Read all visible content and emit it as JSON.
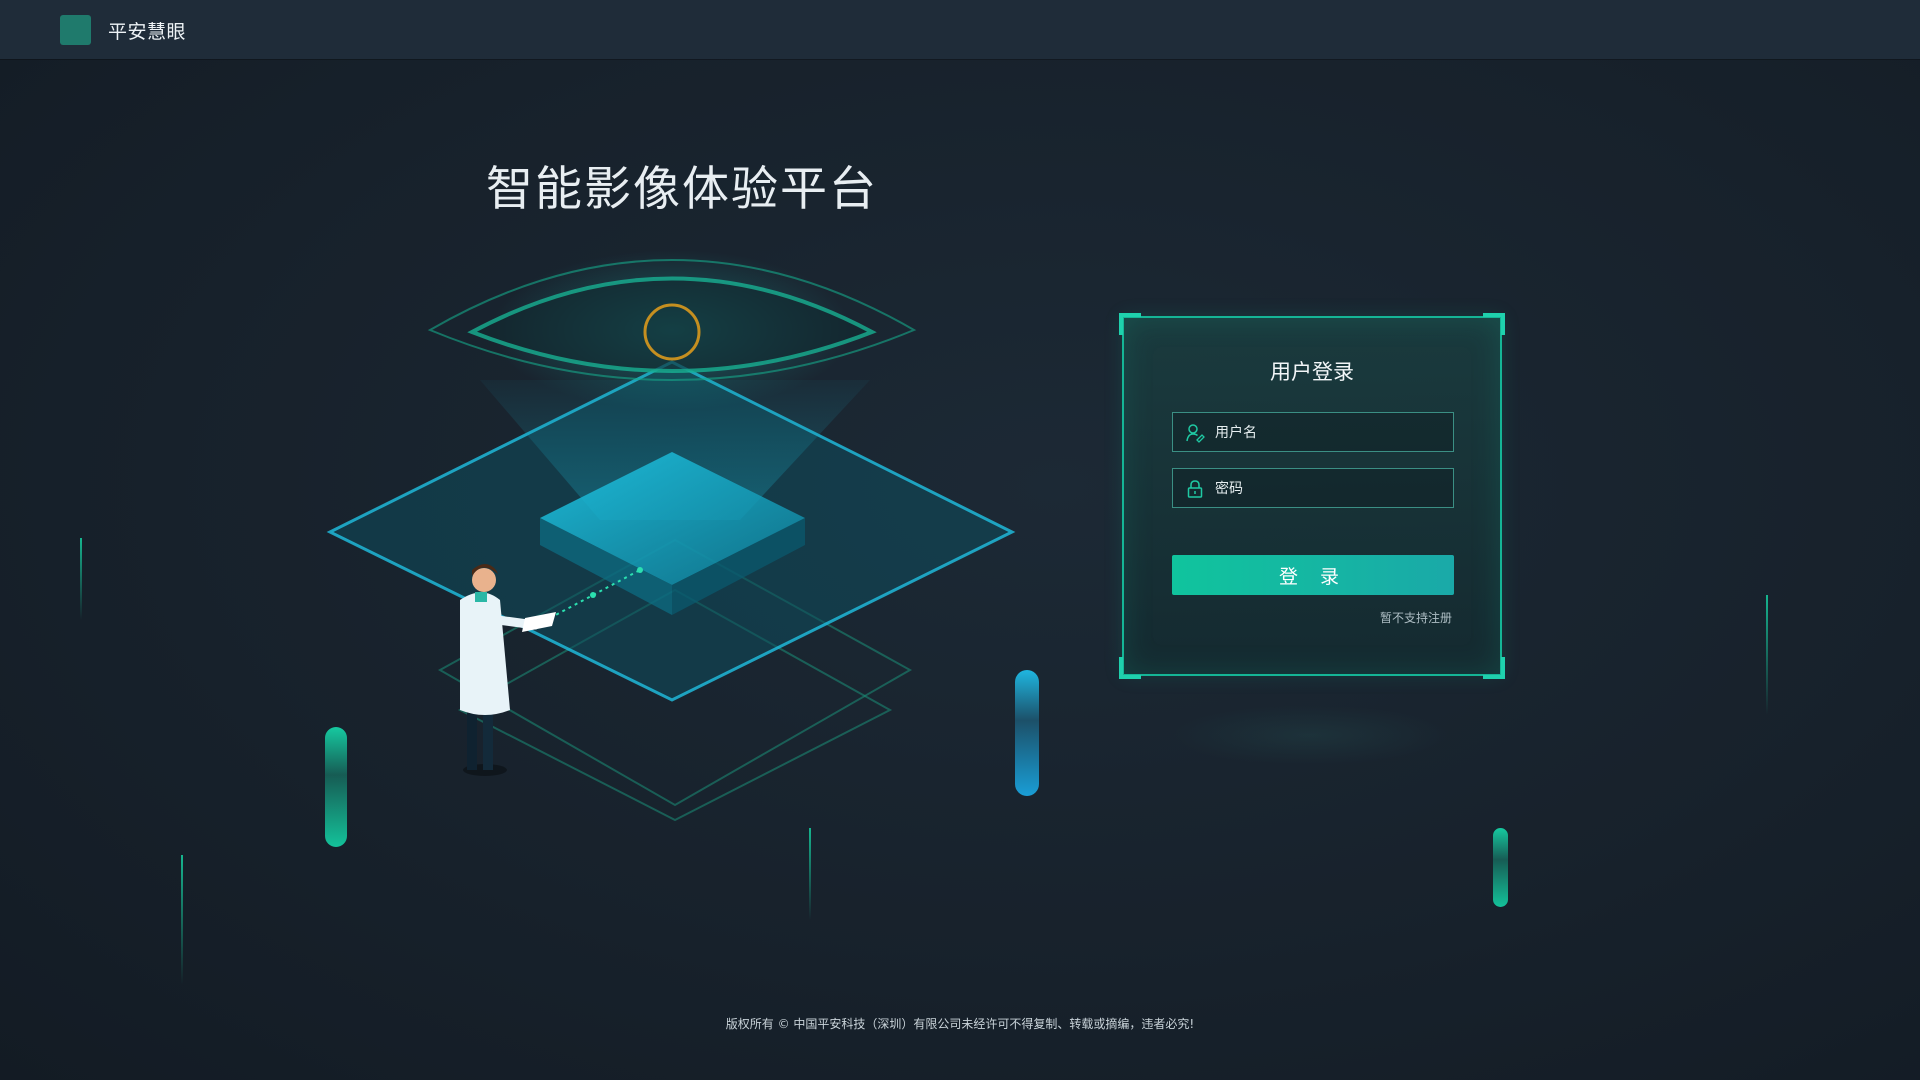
{
  "header": {
    "brand": "平安慧眼"
  },
  "main": {
    "title": "智能影像体验平台"
  },
  "login": {
    "title": "用户登录",
    "username_placeholder": "用户名",
    "password_placeholder": "密码",
    "submit_label": "登 录",
    "register_note": "暂不支持注册"
  },
  "footer": {
    "copyright": "版权所有 © 中国平安科技（深圳）有限公司未经许可不得复制、转载或摘编，违者必究!"
  },
  "colors": {
    "accent": "#15b596",
    "button_start": "#10c49d",
    "button_end": "#1aa9a8",
    "cyan": "#19c3e6",
    "background": "#18222d"
  }
}
